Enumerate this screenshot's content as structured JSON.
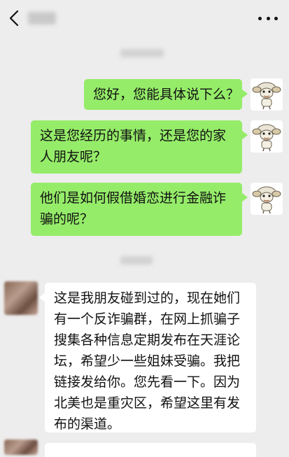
{
  "header": {
    "back_icon": "chevron-left-icon",
    "more_icon": "more-dots-icon"
  },
  "messages": [
    {
      "side": "right",
      "text": "您好，您能具体说下么？"
    },
    {
      "side": "right",
      "text": "这是您经历的事情，还是您的家人朋友呢？"
    },
    {
      "side": "right",
      "text": "他们是如何假借婚恋进行金融诈骗的呢？"
    },
    {
      "side": "left",
      "text": "这是我朋友碰到过的，现在她们有一个反诈骗群，在网上抓骗子搜集各种信息定期发布在天涯论坛，希望少一些姐妹受骗。我把链接发给你。您先看一下。因为北美也是重灾区，希望这里有发布的渠道。"
    }
  ],
  "colors": {
    "background": "#ededed",
    "outgoing_bubble": "#95ec69",
    "incoming_bubble": "#ffffff"
  }
}
